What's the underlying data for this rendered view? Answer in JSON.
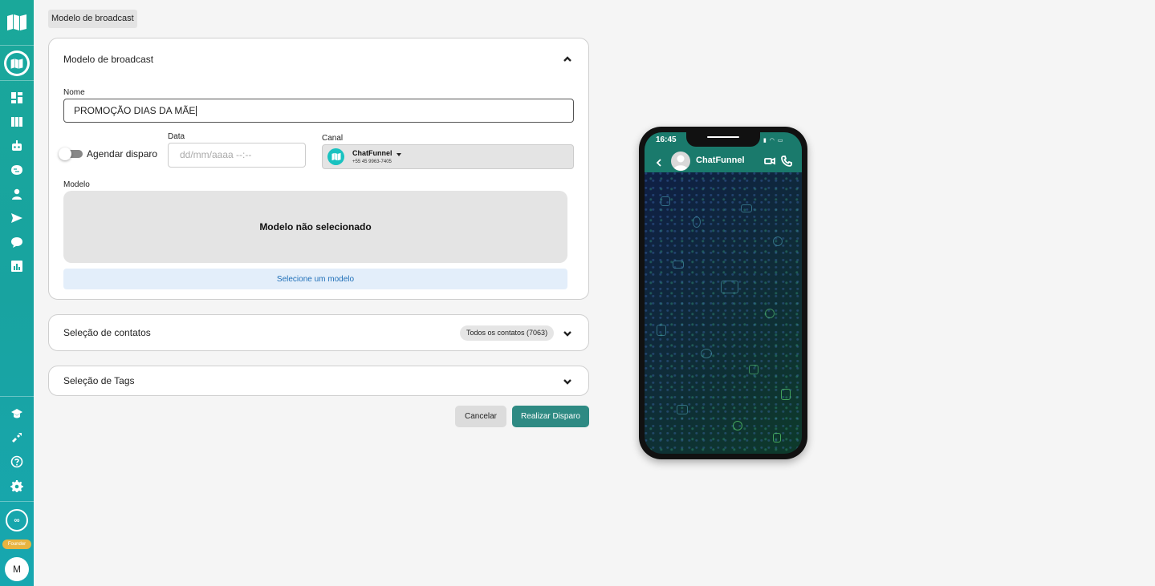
{
  "sidebar": {
    "icons": [
      "logo-icon",
      "home-logo-icon",
      "dashboard-icon",
      "kanban-icon",
      "bot-icon",
      "brain-icon",
      "contacts-icon",
      "broadcast-send-icon",
      "chat-icon",
      "reports-icon",
      "academy-icon",
      "integrations-icon",
      "help-icon",
      "settings-icon"
    ],
    "ring_label": "∞",
    "founder_badge": "Founder",
    "avatar_initial": "M"
  },
  "breadcrumb": "Modelo de broadcast",
  "broadcast_card": {
    "title": "Modelo de broadcast",
    "name_label": "Nome",
    "name_value": "PROMOÇÃO DIAS DA MÃE",
    "schedule_toggle_label": "Agendar disparo",
    "schedule_toggle_on": false,
    "date_label": "Data",
    "date_placeholder": "dd/mm/aaaa --:--",
    "channel_label": "Canal",
    "channel_name": "ChatFunnel",
    "channel_phone": "+55 45 9963-7405",
    "model_label": "Modelo",
    "model_empty_text": "Modelo não selecionado",
    "select_model_button": "Selecione um modelo"
  },
  "contacts_card": {
    "title": "Seleção de contatos",
    "chip": "Todos os contatos (7063)"
  },
  "tags_card": {
    "title": "Seleção de Tags"
  },
  "actions": {
    "cancel": "Cancelar",
    "submit": "Realizar Disparo"
  },
  "phone_preview": {
    "time": "16:45",
    "contact_name": "ChatFunnel"
  },
  "colors": {
    "sidebar": "#1aa89a",
    "primary_button": "#2e8a83",
    "whatsapp_header": "#1a7a6c",
    "select_model_bg": "#e3eefa",
    "select_model_text": "#1f6fb8"
  }
}
